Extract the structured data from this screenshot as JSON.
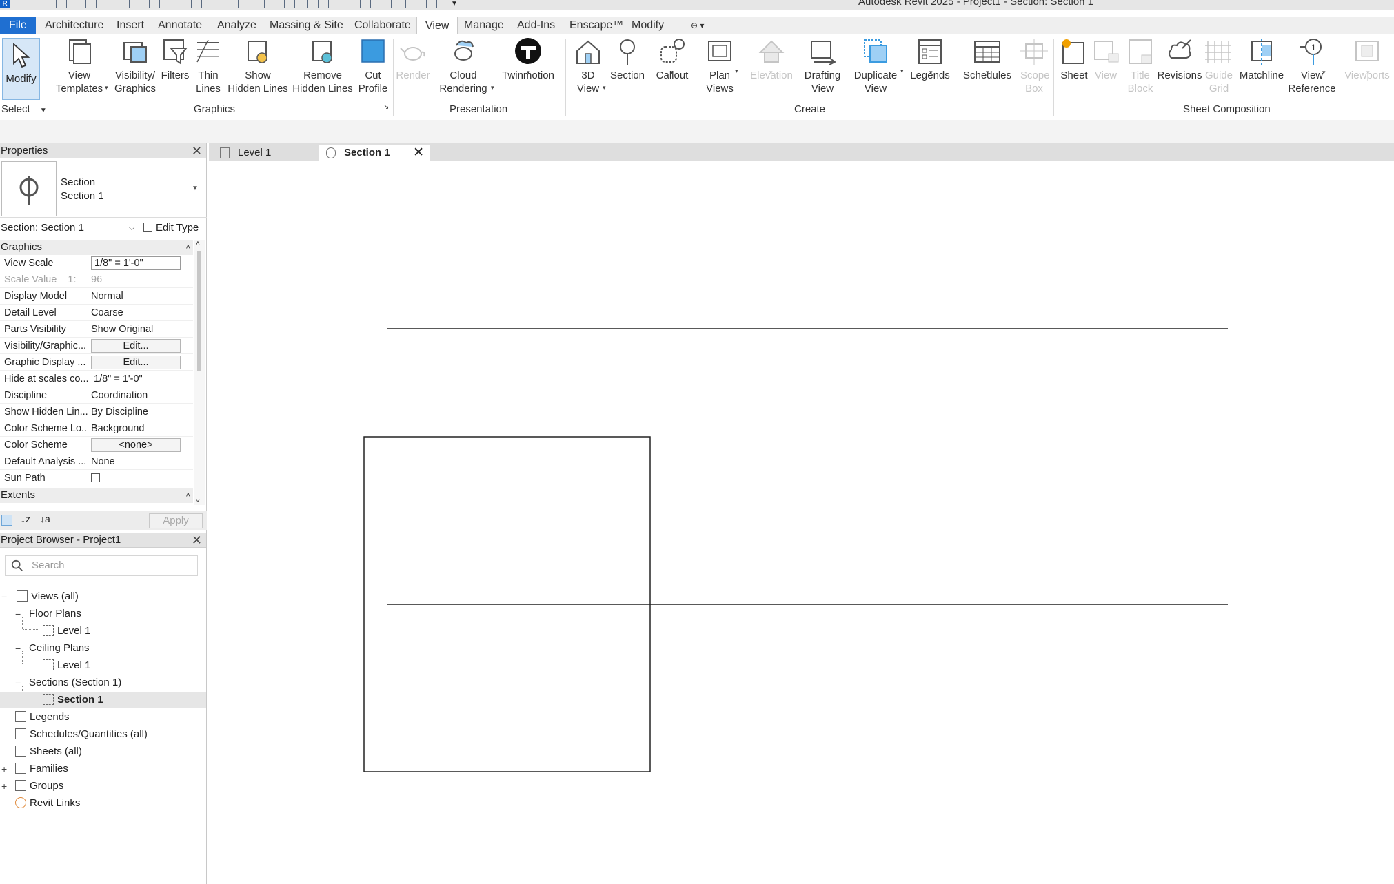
{
  "window": {
    "title": "Autodesk Revit 2025 - Project1 - Section: Section 1"
  },
  "ribbon_tabs": [
    "File",
    "Architecture",
    "Insert",
    "Annotate",
    "Analyze",
    "Massing & Site",
    "Collaborate",
    "View",
    "Manage",
    "Add-Ins",
    "Enscape™",
    "Modify"
  ],
  "active_tab": "View",
  "ribbon": {
    "modify": "Modify",
    "select": "Select",
    "graphics": {
      "label": "Graphics",
      "buttons": [
        {
          "line1": "View",
          "line2": "Templates"
        },
        {
          "line1": "Visibility/",
          "line2": "Graphics"
        },
        {
          "line1": "Filters",
          "line2": ""
        },
        {
          "line1": "Thin",
          "line2": "Lines"
        },
        {
          "line1": "Show",
          "line2": "Hidden Lines"
        },
        {
          "line1": "Remove",
          "line2": "Hidden Lines"
        },
        {
          "line1": "Cut",
          "line2": "Profile"
        }
      ]
    },
    "presentation": {
      "label": "Presentation",
      "buttons": [
        {
          "line1": "Render",
          "line2": ""
        },
        {
          "line1": "Cloud",
          "line2": "Rendering"
        },
        {
          "line1": "Twinmotion",
          "line2": ""
        }
      ]
    },
    "create": {
      "label": "Create",
      "buttons": [
        {
          "line1": "3D",
          "line2": "View"
        },
        {
          "line1": "Section",
          "line2": ""
        },
        {
          "line1": "Callout",
          "line2": ""
        },
        {
          "line1": "Plan",
          "line2": "Views"
        },
        {
          "line1": "Elevation",
          "line2": ""
        },
        {
          "line1": "Drafting",
          "line2": "View"
        },
        {
          "line1": "Duplicate",
          "line2": "View"
        },
        {
          "line1": "Legends",
          "line2": ""
        },
        {
          "line1": "Schedules",
          "line2": ""
        },
        {
          "line1": "Scope",
          "line2": "Box"
        }
      ]
    },
    "sheet_composition": {
      "label": "Sheet Composition",
      "buttons": [
        {
          "line1": "Sheet",
          "line2": ""
        },
        {
          "line1": "View",
          "line2": ""
        },
        {
          "line1": "Title",
          "line2": "Block"
        },
        {
          "line1": "Revisions",
          "line2": ""
        },
        {
          "line1": "Guide",
          "line2": "Grid"
        },
        {
          "line1": "Matchline",
          "line2": ""
        },
        {
          "line1": "View",
          "line2": "Reference"
        },
        {
          "line1": "Viewports",
          "line2": ""
        }
      ]
    }
  },
  "properties": {
    "header": "Properties",
    "type_line1": "Section",
    "type_line2": "Section 1",
    "instance": "Section: Section 1",
    "edit_type": "Edit Type",
    "group_graphics": "Graphics",
    "group_extents": "Extents",
    "rows": [
      {
        "key": "View Scale",
        "value": "1/8\" = 1'-0\""
      },
      {
        "key": "Scale Value    1:",
        "value": "96"
      },
      {
        "key": "Display Model",
        "value": "Normal"
      },
      {
        "key": "Detail Level",
        "value": "Coarse"
      },
      {
        "key": "Parts Visibility",
        "value": "Show Original"
      },
      {
        "key": "Visibility/Graphic...",
        "value": "Edit..."
      },
      {
        "key": "Graphic Display ...",
        "value": "Edit..."
      },
      {
        "key": "Hide at scales co...",
        "value": "1/8\" = 1'-0\""
      },
      {
        "key": "Discipline",
        "value": "Coordination"
      },
      {
        "key": "Show Hidden Lin...",
        "value": "By Discipline"
      },
      {
        "key": "Color Scheme Lo...",
        "value": "Background"
      },
      {
        "key": "Color Scheme",
        "value": "<none>"
      },
      {
        "key": "Default Analysis ...",
        "value": "None"
      },
      {
        "key": "Sun Path",
        "value": ""
      }
    ],
    "apply": "Apply"
  },
  "browser": {
    "header": "Project Browser - Project1",
    "search_placeholder": "Search",
    "nodes": {
      "views": "Views (all)",
      "floor_plans": "Floor Plans",
      "fp_level1": "Level 1",
      "ceiling_plans": "Ceiling Plans",
      "cp_level1": "Level 1",
      "sections": "Sections (Section 1)",
      "section1": "Section 1",
      "legends": "Legends",
      "schedules": "Schedules/Quantities (all)",
      "sheets": "Sheets (all)",
      "families": "Families",
      "groups": "Groups",
      "revit_links": "Revit Links"
    }
  },
  "view_tabs": [
    "Level 1",
    "Section 1"
  ],
  "active_view_tab": "Section 1",
  "colors": {
    "file_tab": "#1f6fd1",
    "selection": "#d6e7f7",
    "accent_icon": "#3b9be0",
    "sun_icon": "#f0a000"
  }
}
